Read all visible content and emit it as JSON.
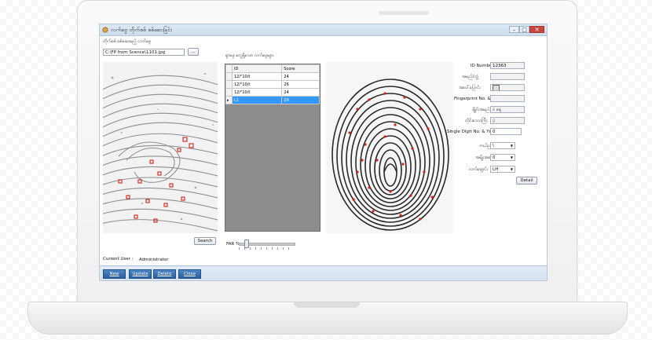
{
  "window": {
    "title": "လက်ဗွေ တိုက်စစ် စစ်ဆေးခြင်း",
    "minimize": "–",
    "maximize": "□",
    "close": "✕"
  },
  "left_panel": {
    "section_label": "တိုက်စစ် စစ်ဆေးမည့် လက်ဗွေ",
    "file_path": "C:\\FP from Scence\\1101.jpg",
    "browse_label": "...",
    "search_label": "Search"
  },
  "middle_panel": {
    "section_label": "ရှာဖွေ တွေ့ရှိသော လက်ဗွေများ",
    "columns": [
      "ID",
      "Score"
    ],
    "rows": [
      {
        "id": "12/\"10/t",
        "score": "24",
        "selected": false
      },
      {
        "id": "12/\"10/t",
        "score": "26",
        "selected": false
      },
      {
        "id": "12/\"10/t",
        "score": "24",
        "selected": false
      },
      {
        "id": "L1",
        "score": "29",
        "selected": true
      }
    ],
    "far_label": "FAR %"
  },
  "details": {
    "id_number_label": "ID Number",
    "id_number_value": "12363",
    "name_label": "အမည်/ဘွဲ့",
    "name_value": "",
    "photo_label": "အပေါ်ပြောင်း",
    "photo_value": "",
    "fingerprint_no_label": "Fingerprint No. & Yr",
    "fingerprint_no_value": "",
    "fields": [
      {
        "label": "ချိုင်းအမည်",
        "value": "ဝဲ ရှေ"
      },
      {
        "label": "တိုင်းဒေသကြီး",
        "value": "ပုံ"
      }
    ],
    "single_digit_label": "Single Digit No. & Yr",
    "single_digit_value": "0",
    "dropdowns": [
      {
        "label": "ဘယ်ညာ",
        "value": "\\"
      },
      {
        "label": "အမျိုးအစား",
        "value": "0"
      },
      {
        "label": "လက်ချောင်း",
        "value": "LH"
      }
    ],
    "detail_label": "Detail"
  },
  "status": {
    "current_user_label": "Current User :",
    "current_user_value": "Administrator"
  },
  "actions": {
    "new": "New",
    "update": "Update",
    "delete": "Delete",
    "close": "Close"
  },
  "colors": {
    "accent": "#2c5f9e",
    "selection": "#3399ff",
    "minutiae": "#d32020"
  }
}
